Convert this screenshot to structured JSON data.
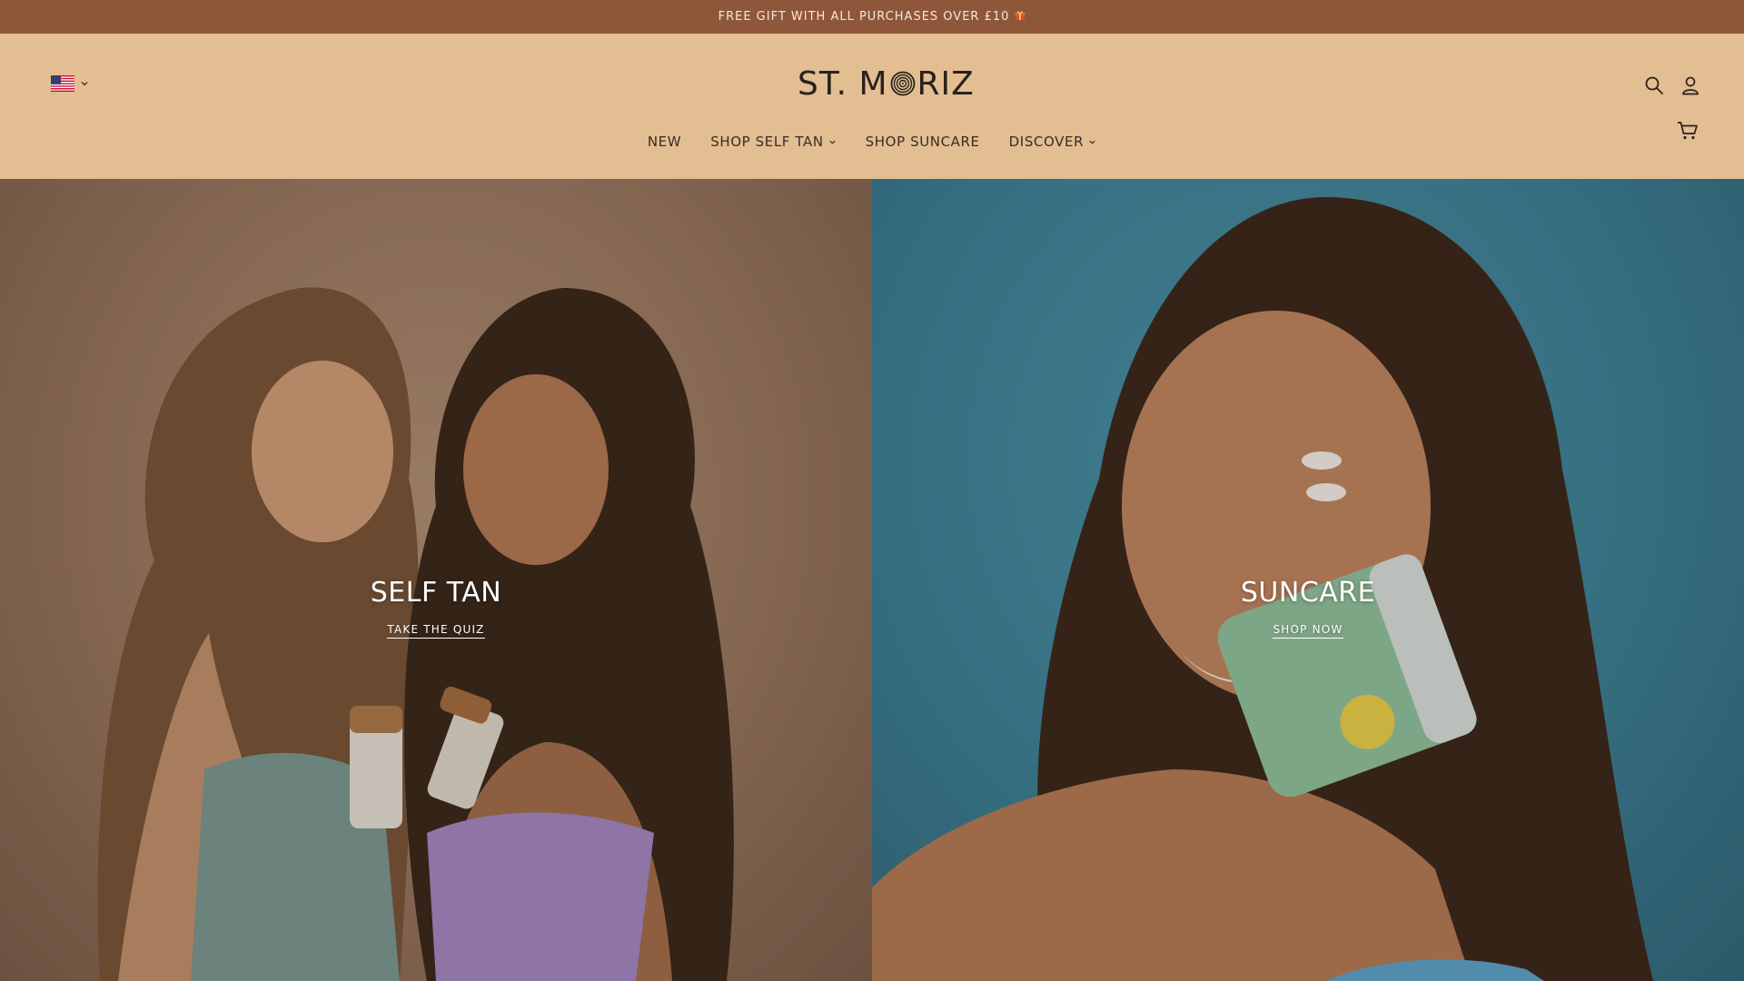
{
  "announcement": {
    "text": "FREE GIFT WITH ALL PURCHASES OVER £10",
    "icon": "gift-icon"
  },
  "header": {
    "country": {
      "flag": "us-flag-icon",
      "chevron": "chevron-down-icon"
    },
    "logo": {
      "text_left": "ST. M",
      "text_right": "RIZ"
    },
    "icons": [
      "search-icon",
      "account-icon",
      "cart-icon"
    ]
  },
  "nav": {
    "items": [
      {
        "label": "NEW",
        "has_dropdown": false
      },
      {
        "label": "SHOP SELF TAN",
        "has_dropdown": true
      },
      {
        "label": "SHOP SUNCARE",
        "has_dropdown": false
      },
      {
        "label": "DISCOVER",
        "has_dropdown": true
      }
    ]
  },
  "heroes": [
    {
      "title": "SELF TAN",
      "link": "TAKE THE QUIZ"
    },
    {
      "title": "SUNCARE",
      "link": "SHOP NOW"
    }
  ],
  "colors": {
    "announcement_bg": "#8f573a",
    "header_bg": "#e2be92",
    "left_hero_bg": "#9b7860",
    "right_hero_bg": "#3c8299"
  }
}
